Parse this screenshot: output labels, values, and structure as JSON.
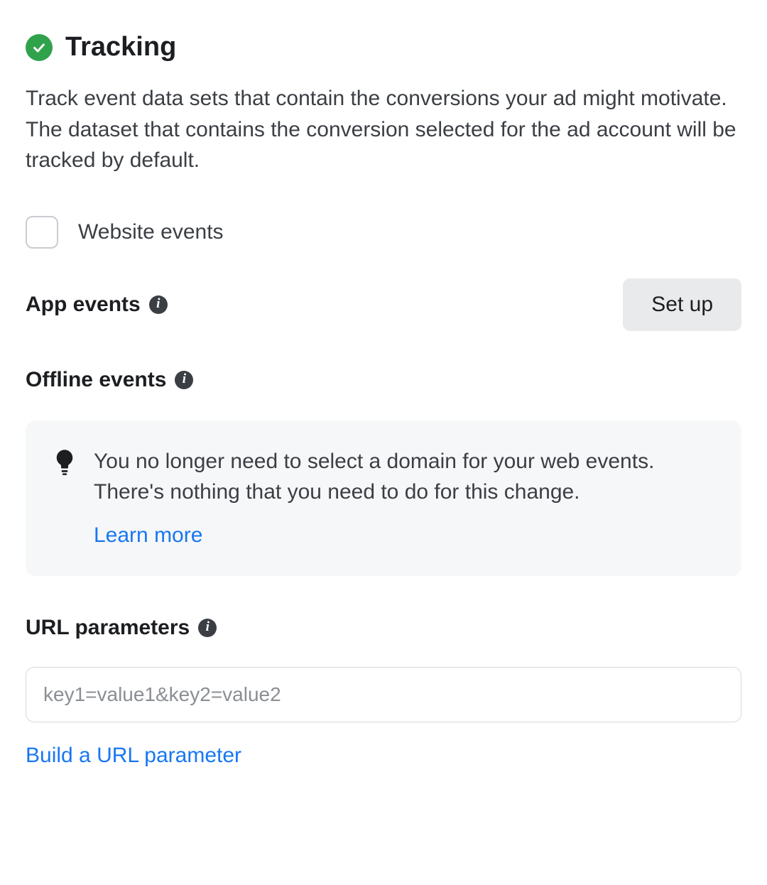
{
  "header": {
    "title": "Tracking"
  },
  "description": "Track event data sets that contain the conversions your ad might motivate. The dataset that contains the conversion selected for the ad account will be tracked by default.",
  "website_events": {
    "label": "Website events",
    "checked": false
  },
  "app_events": {
    "label": "App events",
    "setup_button": "Set up"
  },
  "offline_events": {
    "label": "Offline events"
  },
  "info_box": {
    "text": "You no longer need to select a domain for your web events. There's nothing that you need to do for this change.",
    "learn_more": "Learn more"
  },
  "url_parameters": {
    "label": "URL parameters",
    "placeholder": "key1=value1&key2=value2",
    "value": "",
    "build_link": "Build a URL parameter"
  }
}
